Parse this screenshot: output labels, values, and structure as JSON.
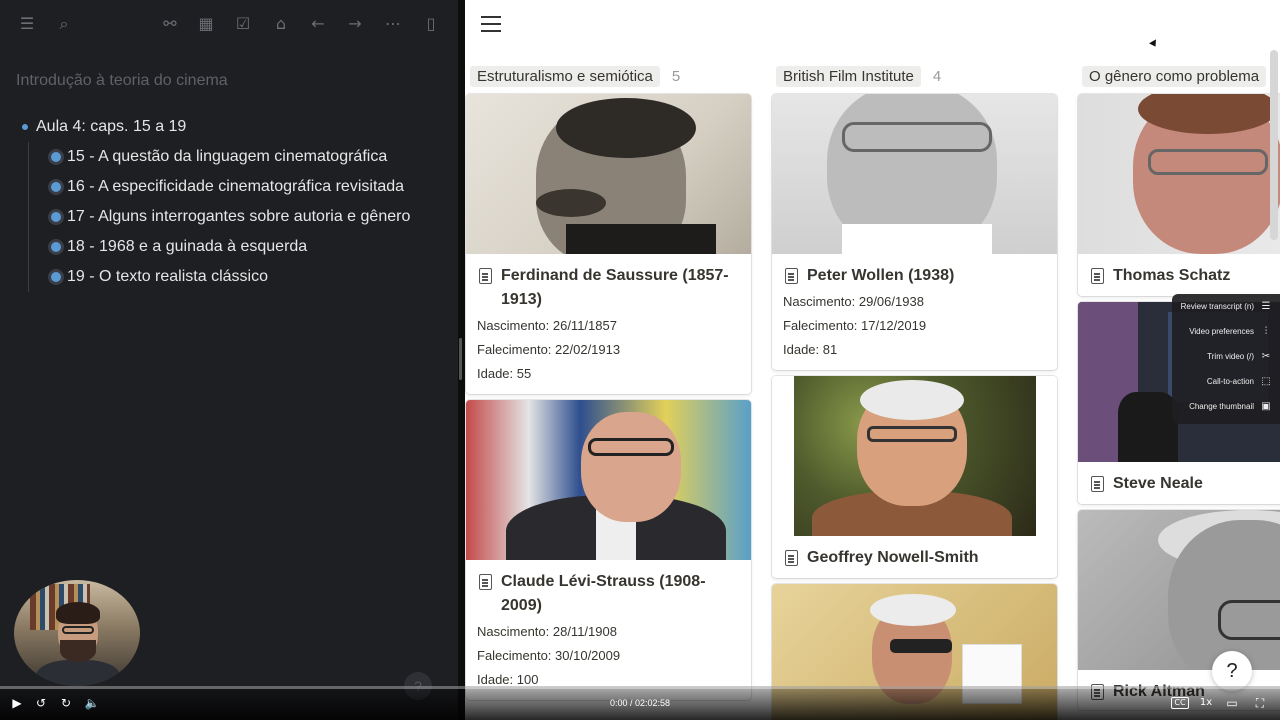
{
  "left_panel": {
    "toolbar_icons": [
      "menu-icon",
      "search-icon",
      "graph-icon",
      "calendar-icon",
      "checkbox-icon",
      "home-icon",
      "arrow-left-icon",
      "arrow-right-icon",
      "more-icon",
      "sidebar-icon"
    ],
    "doc_title": "Introdução à teoria do cinema",
    "outline": {
      "parent": "Aula 4: caps. 15 a 19",
      "children": [
        "15 - A questão da linguagem cinematográfica",
        "16 - A especificidade cinematográfica revisitada",
        "17 - Alguns interrogantes sobre autoria e gênero",
        "18 - 1968 e a guinada à esquerda",
        "19 - O texto realista clássico"
      ]
    },
    "help_ghost": "?"
  },
  "board": {
    "columns": [
      {
        "name": "Estruturalismo e semiótica",
        "count": "5",
        "cards": [
          {
            "title": "Ferdinand de Saussure (1857-1913)",
            "props": [
              "Nascimento: 26/11/1857",
              "Falecimento: 22/02/1913",
              "Idade: 55"
            ]
          },
          {
            "title": "Claude Lévi-Strauss (1908-2009)",
            "props": [
              "Nascimento: 28/11/1908",
              "Falecimento: 30/10/2009",
              "Idade: 100"
            ]
          }
        ]
      },
      {
        "name": "British Film Institute",
        "count": "4",
        "cards": [
          {
            "title": "Peter Wollen (1938)",
            "props": [
              "Nascimento: 29/06/1938",
              "Falecimento: 17/12/2019",
              "Idade: 81"
            ]
          },
          {
            "title": "Geoffrey Nowell-Smith",
            "props": []
          }
        ]
      },
      {
        "name": "O gênero como problema",
        "count": "",
        "cards": [
          {
            "title": "Thomas Schatz",
            "props": []
          },
          {
            "title": "Steve Neale",
            "props": []
          },
          {
            "title": "Rick Altman",
            "props": []
          }
        ]
      }
    ]
  },
  "loom_menu": [
    {
      "label": "Review transcript (n)",
      "icon": "transcript-icon",
      "glyph": "☰"
    },
    {
      "label": "Video preferences",
      "icon": "sliders-icon",
      "glyph": "⫶"
    },
    {
      "label": "Trim video (/)",
      "icon": "scissors-icon",
      "glyph": "✂"
    },
    {
      "label": "Call-to-action",
      "icon": "cursor-click-icon",
      "glyph": "⬚"
    },
    {
      "label": "Change thumbnail",
      "icon": "image-icon",
      "glyph": "▣"
    }
  ],
  "help_button": "?",
  "player": {
    "time": "0:00 / 02:02:58",
    "speed": "1x",
    "cc": "CC"
  }
}
